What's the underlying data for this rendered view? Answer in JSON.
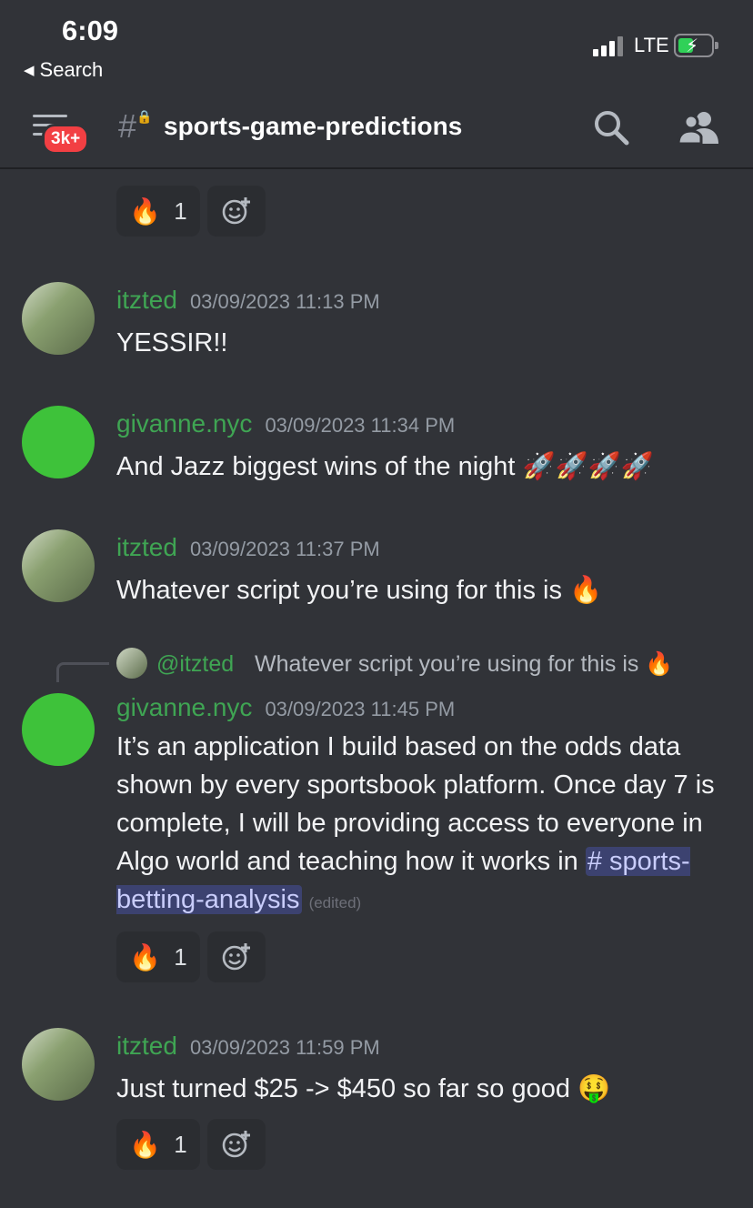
{
  "status_bar": {
    "time": "6:09",
    "back_label": "Search",
    "network": "LTE",
    "battery_icon": "battery-charging-icon"
  },
  "header": {
    "unread_badge": "3k+",
    "channel_name": "sports-game-predictions",
    "channel_icon": "locked-hash-icon",
    "search_icon": "search-icon",
    "members_icon": "members-icon"
  },
  "colors": {
    "background": "#313338",
    "username": "#3fa553",
    "mention_bg": "#3c4270",
    "badge": "#f23f43"
  },
  "top_reactions": [
    {
      "emoji": "🔥",
      "count": "1"
    }
  ],
  "messages": [
    {
      "author": "itzted",
      "timestamp": "03/09/2023 11:13 PM",
      "text": "YESSIR!!"
    },
    {
      "author": "givanne.nyc",
      "timestamp": "03/09/2023 11:34 PM",
      "text": "And Jazz biggest wins of the night 🚀🚀🚀🚀"
    },
    {
      "author": "itzted",
      "timestamp": "03/09/2023 11:37 PM",
      "text": "Whatever script you’re using for this is 🔥"
    },
    {
      "reply_to": {
        "author": "@itzted",
        "text": "Whatever script you’re using for this is 🔥"
      },
      "author": "givanne.nyc",
      "timestamp": "03/09/2023 11:45 PM",
      "text_before": "It’s an application I build based on the odds data shown by every sportsbook platform. Once day 7 is complete, I will be providing access to everyone in Algo world and teaching how it works in ",
      "channel_mention": "# sports-betting-analysis",
      "edited": "(edited)",
      "reactions": [
        {
          "emoji": "🔥",
          "count": "1"
        }
      ]
    },
    {
      "author": "itzted",
      "timestamp": "03/09/2023 11:59 PM",
      "text": "Just turned $25 -> $450 so far so good 🤑",
      "reactions": [
        {
          "emoji": "🔥",
          "count": "1"
        }
      ]
    }
  ]
}
